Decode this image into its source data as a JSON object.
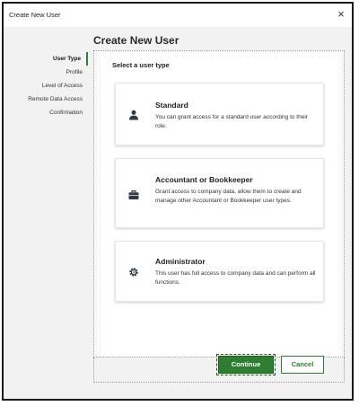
{
  "window": {
    "title": "Create New User",
    "close_glyph": "×"
  },
  "heading": "Create New User",
  "steps": [
    {
      "label": "User Type",
      "active": true
    },
    {
      "label": "Profile",
      "active": false
    },
    {
      "label": "Level of Access",
      "active": false
    },
    {
      "label": "Remote Data Access",
      "active": false
    },
    {
      "label": "Confirmation",
      "active": false
    }
  ],
  "section_title": "Select a user type",
  "user_types": [
    {
      "title": "Standard",
      "description": "You can grant access for a standard user according to their role.",
      "icon": "person-icon"
    },
    {
      "title": "Accountant or Bookkeeper",
      "description": "Grant access to company data, allow them to create and manage other Accountant or Bookkeeper user types.",
      "icon": "briefcase-icon"
    },
    {
      "title": "Administrator",
      "description": "This user has full access to company data and can perform all functions.",
      "icon": "gear-icon"
    }
  ],
  "buttons": {
    "continue": "Continue",
    "cancel": "Cancel"
  },
  "colors": {
    "accent": "#2e7d32",
    "icon": "#2f3a45"
  }
}
